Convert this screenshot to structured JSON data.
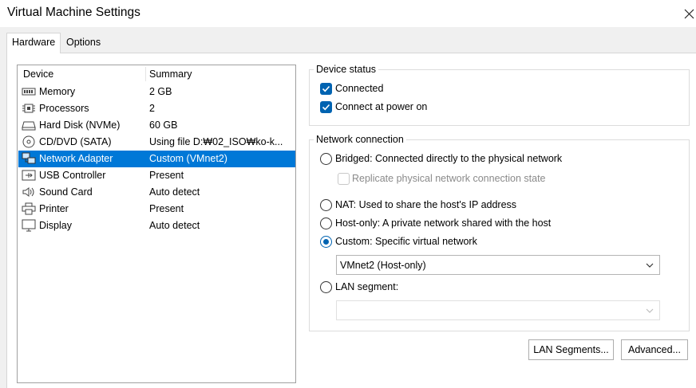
{
  "window": {
    "title": "Virtual Machine Settings"
  },
  "tabs": [
    {
      "label": "Hardware"
    },
    {
      "label": "Options"
    }
  ],
  "device_list": {
    "col_device": "Device",
    "col_summary": "Summary",
    "rows": [
      {
        "name": "Memory",
        "summary": "2 GB",
        "icon": "memory-icon"
      },
      {
        "name": "Processors",
        "summary": "2",
        "icon": "processor-icon"
      },
      {
        "name": "Hard Disk (NVMe)",
        "summary": "60 GB",
        "icon": "hard-disk-icon"
      },
      {
        "name": "CD/DVD (SATA)",
        "summary": "Using file D:₩02_ISO₩ko-k...",
        "icon": "cd-dvd-icon"
      },
      {
        "name": "Network Adapter",
        "summary": "Custom (VMnet2)",
        "icon": "network-adapter-icon",
        "selected": true
      },
      {
        "name": "USB Controller",
        "summary": "Present",
        "icon": "usb-icon"
      },
      {
        "name": "Sound Card",
        "summary": "Auto detect",
        "icon": "sound-icon"
      },
      {
        "name": "Printer",
        "summary": "Present",
        "icon": "printer-icon"
      },
      {
        "name": "Display",
        "summary": "Auto detect",
        "icon": "display-icon"
      }
    ]
  },
  "device_status": {
    "title": "Device status",
    "connected_label": "Connected",
    "connected": true,
    "connect_power_label": "Connect at power on",
    "connect_power": true
  },
  "network_connection": {
    "title": "Network connection",
    "bridged_label": "Bridged: Connected directly to the physical network",
    "replicate_label": "Replicate physical network connection state",
    "nat_label": "NAT: Used to share the host's IP address",
    "hostonly_label": "Host-only: A private network shared with the host",
    "custom_label": "Custom: Specific virtual network",
    "custom_value": "VMnet2 (Host-only)",
    "lan_label": "LAN segment:",
    "lan_value": "",
    "selected": "custom"
  },
  "buttons": {
    "lan_segments": "LAN Segments...",
    "advanced": "Advanced..."
  },
  "colors": {
    "accent": "#0063b1",
    "selection": "#0078d7"
  }
}
